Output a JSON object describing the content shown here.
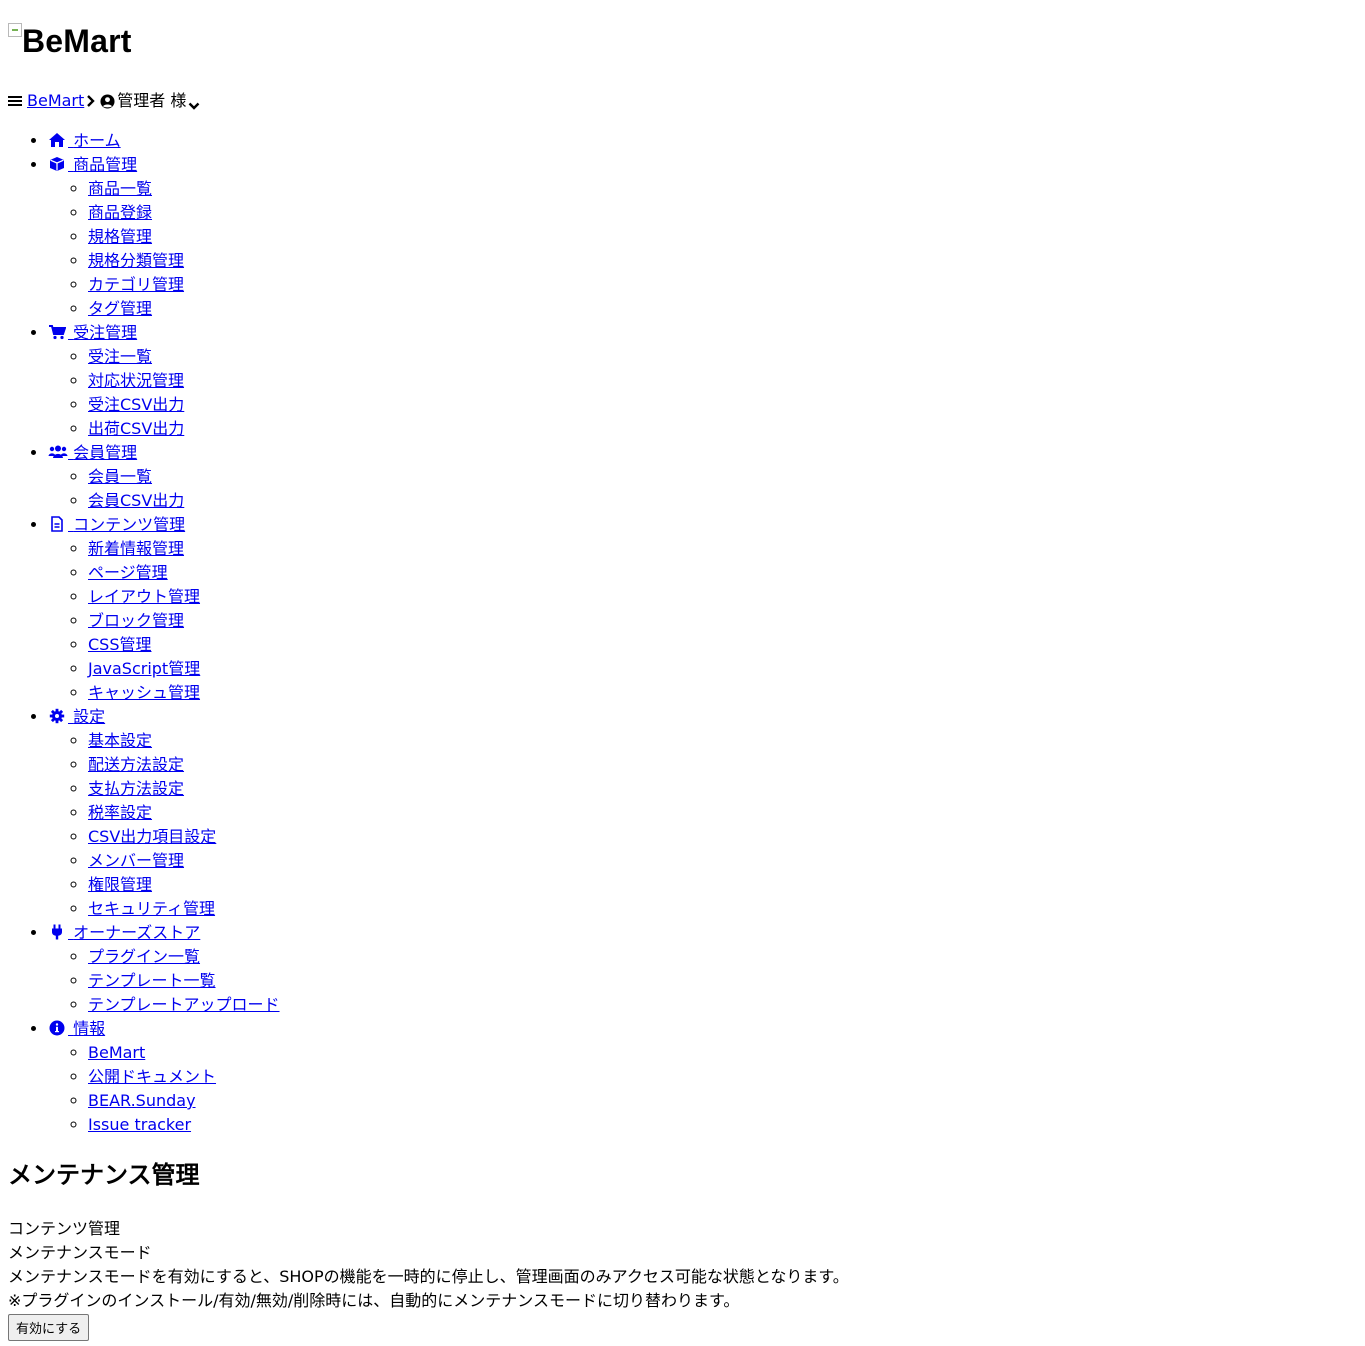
{
  "logo": {
    "alt_text": "BeMart"
  },
  "header": {
    "brand_link": "BeMart",
    "user_label": "管理者 様"
  },
  "nav": {
    "home": "ホーム",
    "products": {
      "label": "商品管理",
      "items": [
        "商品一覧",
        "商品登録",
        "規格管理",
        "規格分類管理",
        "カテゴリ管理",
        "タグ管理"
      ]
    },
    "orders": {
      "label": "受注管理",
      "items": [
        "受注一覧",
        "対応状況管理",
        "受注CSV出力",
        "出荷CSV出力"
      ]
    },
    "members": {
      "label": "会員管理",
      "items": [
        "会員一覧",
        "会員CSV出力"
      ]
    },
    "contents": {
      "label": "コンテンツ管理",
      "items": [
        "新着情報管理",
        "ページ管理",
        "レイアウト管理",
        "ブロック管理",
        "CSS管理",
        "JavaScript管理",
        "キャッシュ管理"
      ]
    },
    "settings": {
      "label": "設定",
      "items": [
        "基本設定",
        "配送方法設定",
        "支払方法設定",
        "税率設定",
        "CSV出力項目設定",
        "メンバー管理",
        "権限管理",
        "セキュリティ管理"
      ]
    },
    "owners_store": {
      "label": "オーナーズストア",
      "items": [
        "プラグイン一覧",
        "テンプレート一覧",
        "テンプレートアップロード"
      ]
    },
    "info": {
      "label": "情報",
      "items": [
        "BeMart",
        "公開ドキュメント",
        "BEAR.Sunday",
        "Issue tracker"
      ]
    }
  },
  "main": {
    "title": "メンテナンス管理",
    "breadcrumb": "コンテンツ管理",
    "section_title": "メンテナンスモード",
    "description": "メンテナンスモードを有効にすると、SHOPの機能を一時的に停止し、管理画面のみアクセス可能な状態となります。",
    "note": "※プラグインのインストール/有効/無効/削除時には、自動的にメンテナンスモードに切り替わります。",
    "enable_button": "有効にする"
  },
  "colors": {
    "link": "#0000ee",
    "text": "#000000",
    "background": "#ffffff"
  }
}
